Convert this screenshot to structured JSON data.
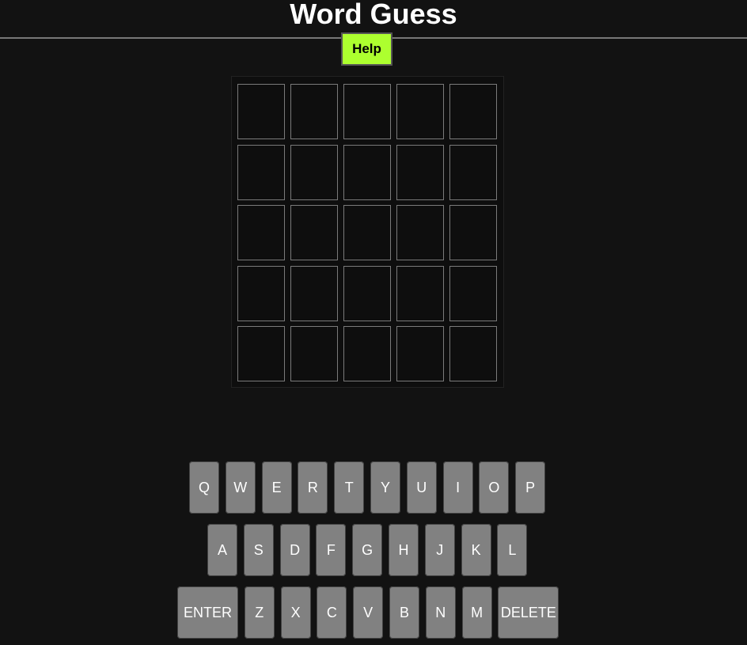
{
  "header": {
    "title": "Word Guess",
    "help_label": "Help"
  },
  "board": {
    "rows": 5,
    "cols": 5,
    "letters": []
  },
  "keyboard": {
    "rows": [
      [
        "Q",
        "W",
        "E",
        "R",
        "T",
        "Y",
        "U",
        "I",
        "O",
        "P"
      ],
      [
        "A",
        "S",
        "D",
        "F",
        "G",
        "H",
        "J",
        "K",
        "L"
      ],
      [
        "ENTER",
        "Z",
        "X",
        "C",
        "V",
        "B",
        "N",
        "M",
        "DELETE"
      ]
    ]
  },
  "colors": {
    "background": "#121212",
    "help": "#adff2f",
    "key": "#818181"
  }
}
